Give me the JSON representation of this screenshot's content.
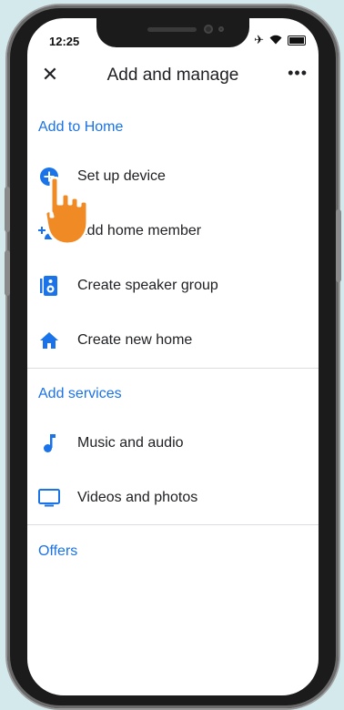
{
  "status": {
    "time": "12:25"
  },
  "header": {
    "title": "Add and manage",
    "more": "•••",
    "close": "✕"
  },
  "sections": {
    "add_to_home": {
      "title": "Add to Home",
      "items": [
        {
          "label": "Set up device",
          "icon": "add-circle-icon"
        },
        {
          "label": "Add home member",
          "icon": "add-person-icon"
        },
        {
          "label": "Create speaker group",
          "icon": "speaker-icon"
        },
        {
          "label": "Create new home",
          "icon": "home-icon"
        }
      ]
    },
    "add_services": {
      "title": "Add services",
      "items": [
        {
          "label": "Music and audio",
          "icon": "music-note-icon"
        },
        {
          "label": "Videos and photos",
          "icon": "tv-icon"
        }
      ]
    },
    "offers": {
      "title": "Offers"
    }
  },
  "colors": {
    "accent": "#1a73e8",
    "hand": "#f08a24",
    "frame": "#1b1b1b"
  }
}
